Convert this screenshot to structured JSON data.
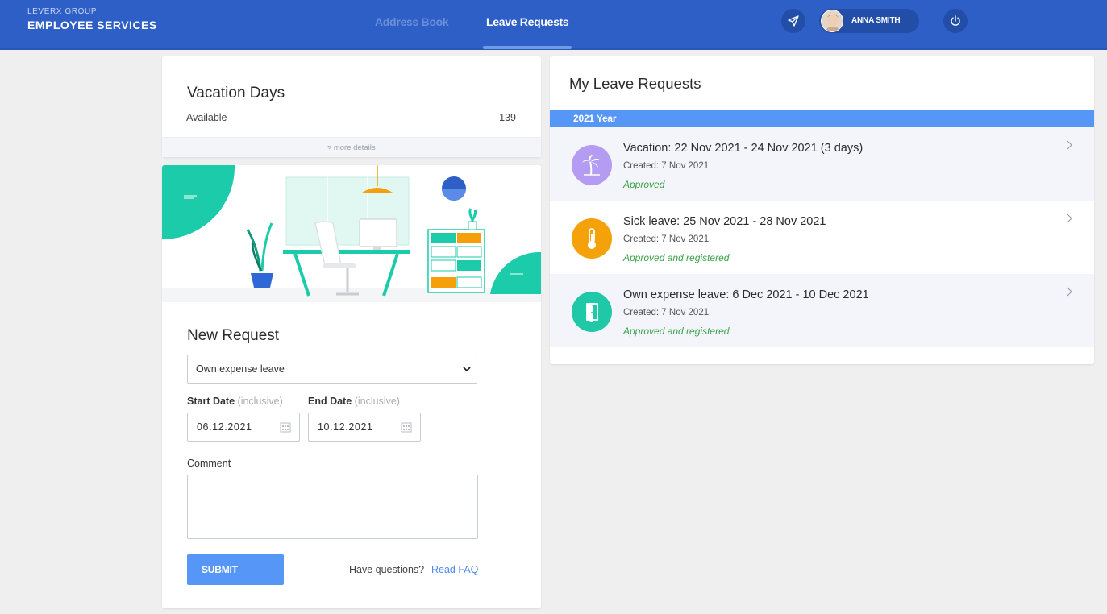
{
  "header": {
    "brand_small": "LEVERX GROUP",
    "brand_big": "EMPLOYEE SERVICES",
    "nav": [
      {
        "label": "Address Book",
        "active": false
      },
      {
        "label": "Leave Requests",
        "active": true
      }
    ],
    "user": {
      "name": "ANNA SMITH"
    },
    "icons": [
      "send-icon",
      "avatar",
      "power-icon"
    ],
    "colors": {
      "bar": "#2d5fc7",
      "accent": "#5596f6"
    }
  },
  "vacation": {
    "title": "Vacation Days",
    "available_label": "Available",
    "available_value": "139",
    "more_details": "more details"
  },
  "new_request": {
    "title": "New Request",
    "type_selected": "Own expense leave",
    "start_label": "Start Date",
    "start_hint": "(inclusive)",
    "start_value": "06.12.2021",
    "end_label": "End Date",
    "end_hint": "(inclusive)",
    "end_value": "10.12.2021",
    "comment_label": "Comment",
    "comment_value": "",
    "submit_label": "SUBMIT",
    "faq_question": "Have questions?",
    "faq_link": "Read FAQ"
  },
  "my_requests": {
    "title": "My Leave Requests",
    "year_label": "2021 Year",
    "items": [
      {
        "title": "Vacation: 22 Nov 2021 - 24 Nov 2021 (3 days)",
        "created": "Created: 7 Nov 2021",
        "status": "Approved",
        "icon": "palm-tree-icon",
        "color": "#b49cf2"
      },
      {
        "title": "Sick leave: 25 Nov 2021 - 28 Nov 2021",
        "created": "Created: 7 Nov 2021",
        "status": "Approved and registered",
        "icon": "thermometer-icon",
        "color": "#f5a20a"
      },
      {
        "title": "Own expense leave: 6 Dec 2021 - 10 Dec 2021",
        "created": "Created: 7 Nov 2021",
        "status": "Approved and registered",
        "icon": "door-icon",
        "color": "#1fc8a6"
      }
    ]
  }
}
